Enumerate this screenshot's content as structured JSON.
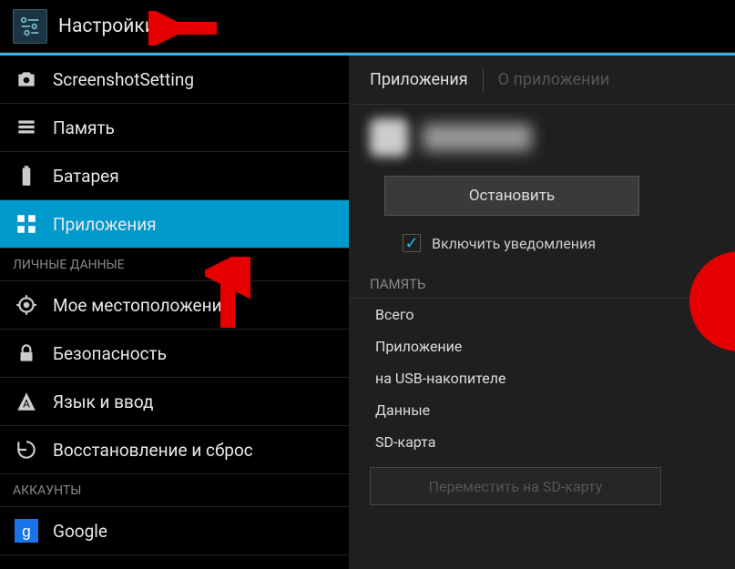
{
  "header": {
    "title": "Настройки"
  },
  "sidebar": {
    "items": [
      {
        "label": "ScreenshotSetting",
        "icon": "camera-icon"
      },
      {
        "label": "Память",
        "icon": "storage-icon"
      },
      {
        "label": "Батарея",
        "icon": "battery-icon"
      },
      {
        "label": "Приложения",
        "icon": "apps-icon",
        "selected": true
      }
    ],
    "section1": "ЛИЧНЫЕ ДАННЫЕ",
    "personal": [
      {
        "label": "Мое местоположение",
        "icon": "location-icon"
      },
      {
        "label": "Безопасность",
        "icon": "lock-icon"
      },
      {
        "label": "Язык и ввод",
        "icon": "language-icon"
      },
      {
        "label": "Восстановление и сброс",
        "icon": "reset-icon"
      }
    ],
    "section2": "АККАУНТЫ",
    "accounts": [
      {
        "label": "Google",
        "icon": "google-icon"
      }
    ]
  },
  "content": {
    "tabs": {
      "active": "Приложения",
      "inactive": "О приложении"
    },
    "stop_button": "Остановить",
    "checkbox_label": "Включить уведомления",
    "checkbox_checked": true,
    "memory_header": "ПАМЯТЬ",
    "rows": [
      "Всего",
      "Приложение",
      "на USB-накопителе",
      "Данные",
      "SD-карта"
    ],
    "move_button": "Переместить на SD-карту"
  }
}
